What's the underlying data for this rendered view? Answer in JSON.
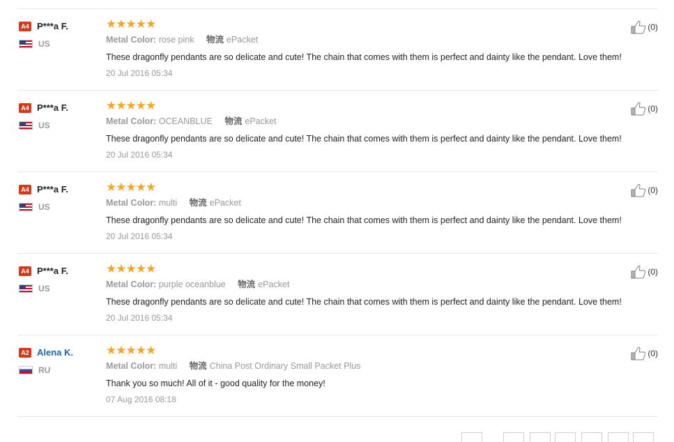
{
  "reviews": [
    {
      "level": "A4",
      "name": "P***a F.",
      "country": "US",
      "flag": "us",
      "name_link": false,
      "stars": "★★★★★",
      "attr_label": "Metal Color:",
      "attr_value": "rose pink",
      "shipping_label": "物流",
      "shipping_value": "ePacket",
      "text": "These dragonfly pendants are so delicate and cute! The chain that comes with them is perfect and dainty like the pendant. Love them!",
      "date": "20 Jul 2016 05:34",
      "helpful": "(0)"
    },
    {
      "level": "A4",
      "name": "P***a F.",
      "country": "US",
      "flag": "us",
      "name_link": false,
      "stars": "★★★★★",
      "attr_label": "Metal Color:",
      "attr_value": "OCEANBLUE",
      "shipping_label": "物流",
      "shipping_value": "ePacket",
      "text": "These dragonfly pendants are so delicate and cute! The chain that comes with them is perfect and dainty like the pendant. Love them!",
      "date": "20 Jul 2016 05:34",
      "helpful": "(0)"
    },
    {
      "level": "A4",
      "name": "P***a F.",
      "country": "US",
      "flag": "us",
      "name_link": false,
      "stars": "★★★★★",
      "attr_label": "Metal Color:",
      "attr_value": "multi",
      "shipping_label": "物流",
      "shipping_value": "ePacket",
      "text": "These dragonfly pendants are so delicate and cute! The chain that comes with them is perfect and dainty like the pendant. Love them!",
      "date": "20 Jul 2016 05:34",
      "helpful": "(0)"
    },
    {
      "level": "A4",
      "name": "P***a F.",
      "country": "US",
      "flag": "us",
      "name_link": false,
      "stars": "★★★★★",
      "attr_label": "Metal Color:",
      "attr_value": "purple oceanblue",
      "shipping_label": "物流",
      "shipping_value": "ePacket",
      "text": "These dragonfly pendants are so delicate and cute! The chain that comes with them is perfect and dainty like the pendant. Love them!",
      "date": "20 Jul 2016 05:34",
      "helpful": "(0)"
    },
    {
      "level": "A2",
      "name": "Alena K.",
      "country": "RU",
      "flag": "ru",
      "name_link": true,
      "stars": "★★★★★",
      "attr_label": "Metal Color:",
      "attr_value": "multi",
      "shipping_label": "物流",
      "shipping_value": "China Post Ordinary Small Packet Plus",
      "text": "Thank you so much! All of it - good quality for the money!",
      "date": "07 Aug 2016 08:18",
      "helpful": "(0)"
    }
  ],
  "colors": {
    "star": "#f5a623",
    "level_badge": "#d43a1a",
    "name_link": "#1a66b3"
  }
}
